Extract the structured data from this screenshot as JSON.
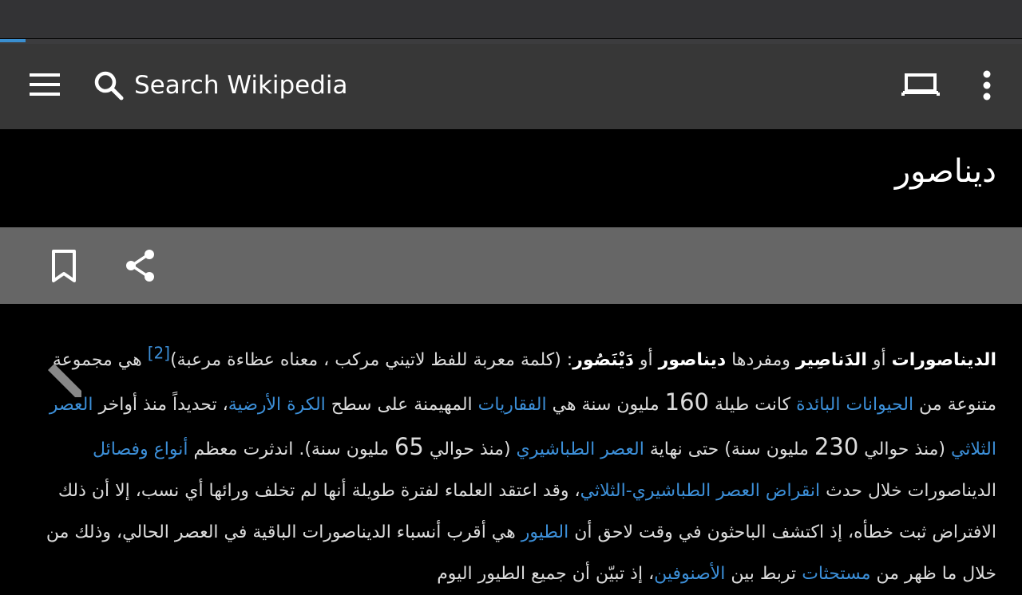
{
  "toolbar": {
    "search_placeholder": "Search Wikipedia",
    "menu_icon": "hamburger-menu-icon",
    "search_icon": "search-icon",
    "tabs_icon": "tabs-icon",
    "overflow_icon": "more-vert-icon"
  },
  "progress": {
    "fraction": 0.025,
    "color": "#3a8fd0"
  },
  "article": {
    "title": "ديناصور",
    "actions": {
      "bookmark_icon": "bookmark-icon",
      "share_icon": "share-icon",
      "edit_icon": "edit-pencil-icon"
    },
    "paragraph": [
      {
        "t": "b",
        "v": "الديناصورات"
      },
      {
        "t": "s",
        "v": " أو "
      },
      {
        "t": "b",
        "v": "الدَناصِير"
      },
      {
        "t": "s",
        "v": " ومفردها "
      },
      {
        "t": "b",
        "v": "ديناصور"
      },
      {
        "t": "s",
        "v": " أو "
      },
      {
        "t": "b",
        "v": "دَيْنَصُور"
      },
      {
        "t": "s",
        "v": ": (كلمة معربة للفظ لاتيني مركب ، معناه عظاءة مرعبة)"
      },
      {
        "t": "sup",
        "v": "[2]"
      },
      {
        "t": "s",
        "v": " هي مجموعة متنوعة من "
      },
      {
        "t": "a",
        "v": "الحيوانات البائدة"
      },
      {
        "t": "s",
        "v": " كانت طيلة "
      },
      {
        "t": "n",
        "v": "160"
      },
      {
        "t": "s",
        "v": " مليون سنة هي "
      },
      {
        "t": "a",
        "v": "الفقاريات"
      },
      {
        "t": "s",
        "v": " المهيمنة على سطح "
      },
      {
        "t": "a",
        "v": "الكرة الأرضية"
      },
      {
        "t": "s",
        "v": "، تحديداً منذ أواخر "
      },
      {
        "t": "a",
        "v": "العصر الثلاثي"
      },
      {
        "t": "s",
        "v": " (منذ حوالي "
      },
      {
        "t": "n",
        "v": "230"
      },
      {
        "t": "s",
        "v": " مليون سنة) حتى نهاية "
      },
      {
        "t": "a",
        "v": "العصر الطباشيري"
      },
      {
        "t": "s",
        "v": " (منذ حوالي "
      },
      {
        "t": "n",
        "v": "65"
      },
      {
        "t": "s",
        "v": " مليون سنة). اندثرت معظم "
      },
      {
        "t": "a",
        "v": "أنواع وفصائل"
      },
      {
        "t": "s",
        "v": " الديناصورات خلال حدث "
      },
      {
        "t": "a",
        "v": "انقراض العصر الطباشيري-الثلاثي"
      },
      {
        "t": "s",
        "v": "، وقد اعتقد العلماء لفترة طويلة أنها لم تخلف ورائها أي نسب، إلا أن ذلك الافتراض ثبت خطأه، إذ اكتشف الباحثون في وقت لاحق أن "
      },
      {
        "t": "a",
        "v": "الطيور"
      },
      {
        "t": "s",
        "v": " هي أقرب أنسباء الديناصورات الباقية في العصر الحالي، وذلك من خلال ما ظهر من "
      },
      {
        "t": "a",
        "v": "مستحثات"
      },
      {
        "t": "s",
        "v": " تربط بين "
      },
      {
        "t": "a",
        "v": "الأصنوفين"
      },
      {
        "t": "s",
        "v": "، إذ تبيّن أن جميع الطيور اليوم"
      }
    ]
  }
}
